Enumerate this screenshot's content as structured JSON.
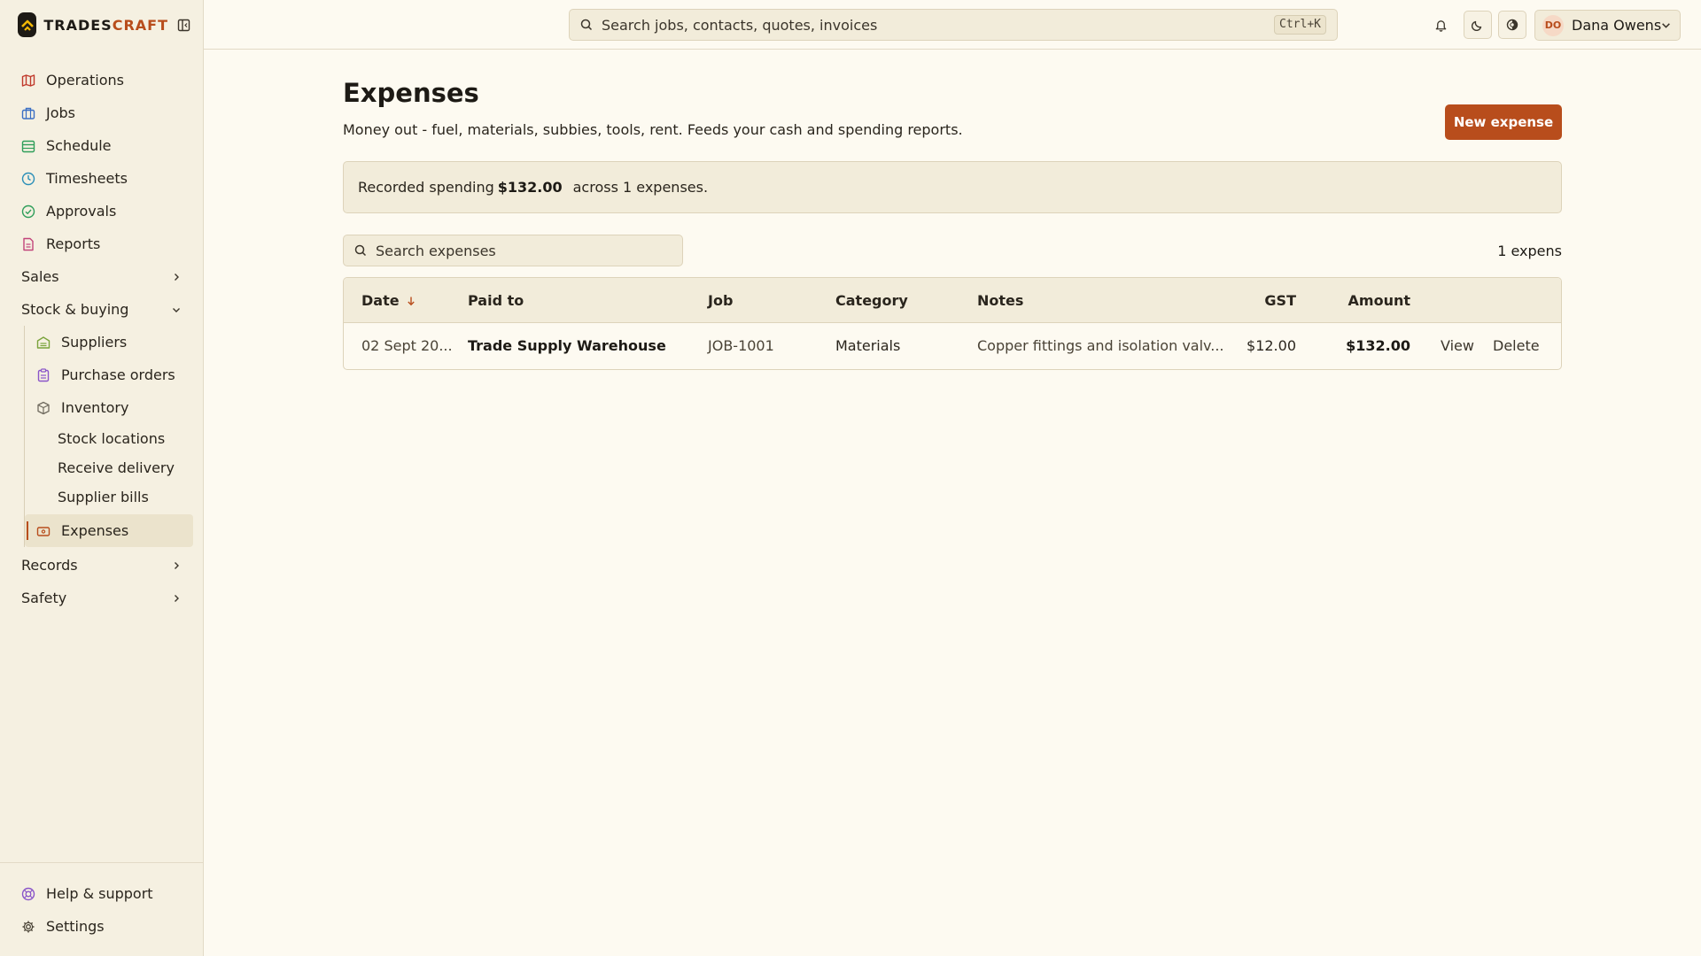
{
  "brand": {
    "name_main": "TRADES",
    "name_accent": "CRAFT"
  },
  "sidebar": {
    "items": [
      {
        "label": "Operations",
        "icon": "map-icon",
        "color": "#c0392b"
      },
      {
        "label": "Jobs",
        "icon": "briefcase-icon",
        "color": "#3b6fc4"
      },
      {
        "label": "Schedule",
        "icon": "calendar-icon",
        "color": "#2f9e5a"
      },
      {
        "label": "Timesheets",
        "icon": "clock-icon",
        "color": "#2b8fb8"
      },
      {
        "label": "Approvals",
        "icon": "check-circle-icon",
        "color": "#2f9e5a"
      },
      {
        "label": "Reports",
        "icon": "report-icon",
        "color": "#c2447a"
      }
    ],
    "groups": {
      "sales": "Sales",
      "stock": "Stock & buying",
      "records": "Records",
      "safety": "Safety"
    },
    "stock_items": [
      {
        "label": "Suppliers",
        "icon": "warehouse-icon",
        "color": "#7aa33b"
      },
      {
        "label": "Purchase orders",
        "icon": "clipboard-icon",
        "color": "#8a55c9"
      },
      {
        "label": "Inventory",
        "icon": "box-icon",
        "color": "#6f6a5e"
      }
    ],
    "inventory_sub": [
      "Stock locations",
      "Receive delivery",
      "Supplier bills"
    ],
    "active_item": {
      "label": "Expenses",
      "icon": "wallet-icon",
      "color": "#b84d1c"
    },
    "footer": {
      "help": "Help & support",
      "settings": "Settings"
    }
  },
  "topbar": {
    "search_placeholder": "Search jobs, contacts, quotes, invoices",
    "shortcut": "Ctrl+K",
    "user": {
      "initials": "DO",
      "name": "Dana Owens"
    }
  },
  "main": {
    "title": "Expenses",
    "subtitle": "Money out - fuel, materials, subbies, tools, rent. Feeds your cash and spending reports.",
    "new_button": "New expense",
    "summary": {
      "prefix": "Recorded spending",
      "amount": "$132.00",
      "suffix": "across 1 expenses."
    },
    "search_placeholder": "Search expenses",
    "count_label": "1 expens"
  },
  "table": {
    "headers": {
      "date": "Date",
      "paid_to": "Paid to",
      "job": "Job",
      "category": "Category",
      "notes": "Notes",
      "gst": "GST",
      "amount": "Amount"
    },
    "rows": [
      {
        "date": "02 Sept 20...",
        "paid_to": "Trade Supply Warehouse",
        "job": "JOB-1001",
        "category": "Materials",
        "notes": "Copper fittings and isolation valv...",
        "gst": "$12.00",
        "amount": "$132.00",
        "view": "View",
        "delete": "Delete"
      }
    ]
  },
  "colors": {
    "accent": "#b84d1c",
    "background": "#fdfaf1",
    "sidebar": "#f5f0e1"
  }
}
